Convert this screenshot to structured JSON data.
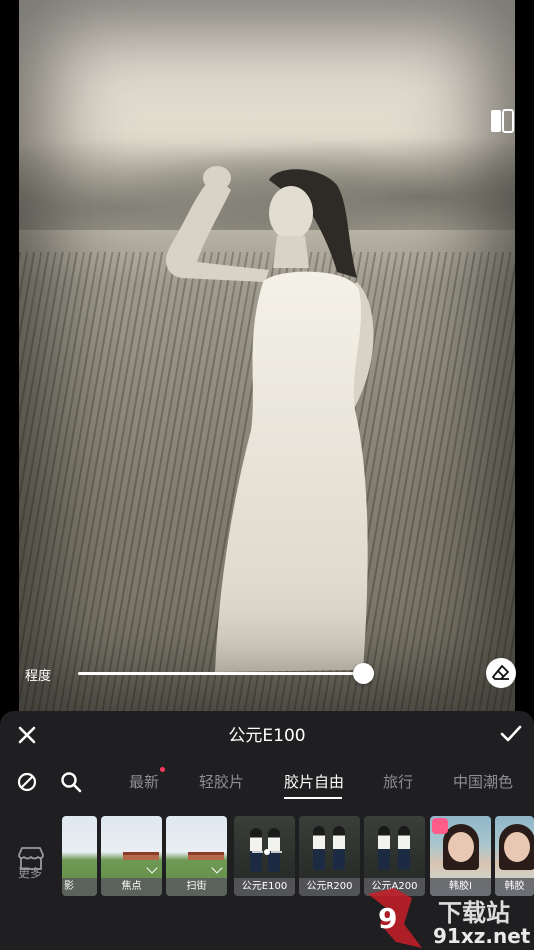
{
  "editor": {
    "intensity_label": "程度",
    "intensity_value": 1.0
  },
  "panel": {
    "title": "公元E100",
    "tabs": [
      {
        "label": "最新",
        "has_dot": true
      },
      {
        "label": "轻胶片"
      },
      {
        "label": "胶片自由",
        "active": true
      },
      {
        "label": "旅行"
      },
      {
        "label": "中国潮色"
      }
    ],
    "more_label": "更多"
  },
  "filters": [
    {
      "label": "影",
      "type": "field"
    },
    {
      "label": "焦点",
      "type": "field"
    },
    {
      "label": "扫街",
      "type": "field"
    },
    {
      "label": "公元E100",
      "type": "people",
      "selected": true
    },
    {
      "label": "公元R200",
      "type": "people"
    },
    {
      "label": "公元A200",
      "type": "people"
    },
    {
      "label": "韩胶I",
      "type": "portrait",
      "favorite": true
    },
    {
      "label": "韩胶",
      "type": "portrait"
    }
  ],
  "watermark": {
    "cn": "下载站",
    "url": "91xz.net"
  },
  "colors": {
    "panel_bg": "#1f1f21",
    "active_text": "#ffffff",
    "inactive_text": "#8e8e93",
    "notify_dot": "#ff3b5c",
    "favorite": "#ff5c8a"
  },
  "icons": [
    "compare-icon",
    "eraser-icon",
    "close-icon",
    "check-icon",
    "no-filter-icon",
    "search-icon",
    "store-icon",
    "heart-icon",
    "download-icon"
  ]
}
